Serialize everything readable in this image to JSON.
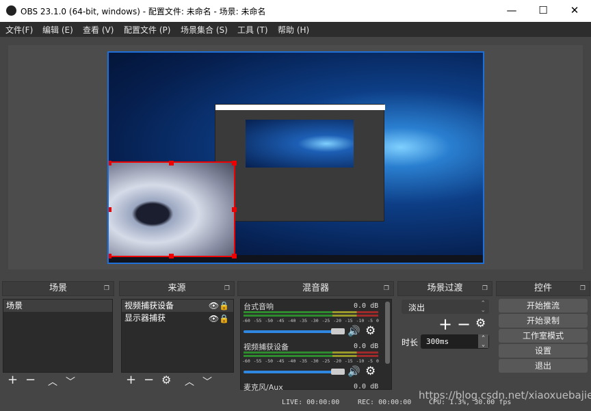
{
  "window": {
    "title": "OBS 23.1.0 (64-bit, windows) - 配置文件: 未命名 - 场景: 未命名",
    "minimize": "—",
    "maximize": "☐",
    "close": "✕"
  },
  "menu": [
    "文件(F)",
    "编辑 (E)",
    "查看 (V)",
    "配置文件 (P)",
    "场景集合 (S)",
    "工具 (T)",
    "帮助 (H)"
  ],
  "docks": {
    "scenes": {
      "title": "场景",
      "items": [
        "场景"
      ]
    },
    "sources": {
      "title": "来源",
      "items": [
        "视频捕获设备",
        "显示器捕获"
      ]
    },
    "mixer": {
      "title": "混音器",
      "channels": [
        {
          "name": "台式音响",
          "db": "0.0 dB"
        },
        {
          "name": "视频捕获设备",
          "db": "0.0 dB"
        },
        {
          "name": "麦克风/Aux",
          "db": "0.0 dB"
        }
      ],
      "ticks": [
        "-60",
        "-55",
        "-50",
        "-45",
        "-40",
        "-35",
        "-30",
        "-25",
        "-20",
        "-15",
        "-10",
        "-5",
        "0"
      ],
      "volume_percent": 100
    },
    "transitions": {
      "title": "场景过渡",
      "selected": "淡出",
      "duration_label": "时长",
      "duration": "300ms"
    },
    "controls": {
      "title": "控件",
      "buttons": [
        "开始推流",
        "开始录制",
        "工作室模式",
        "设置",
        "退出"
      ]
    }
  },
  "status": {
    "live": "LIVE: 00:00:00",
    "rec": "REC: 00:00:00",
    "cpu": "CPU: 1.3%, 30.00 fps"
  },
  "watermark": "https://blog.csdn.net/xiaoxuebajie",
  "colors": {
    "selection": "#e00000",
    "preview_border": "#1e6fd8",
    "slider": "#2f87e0"
  }
}
